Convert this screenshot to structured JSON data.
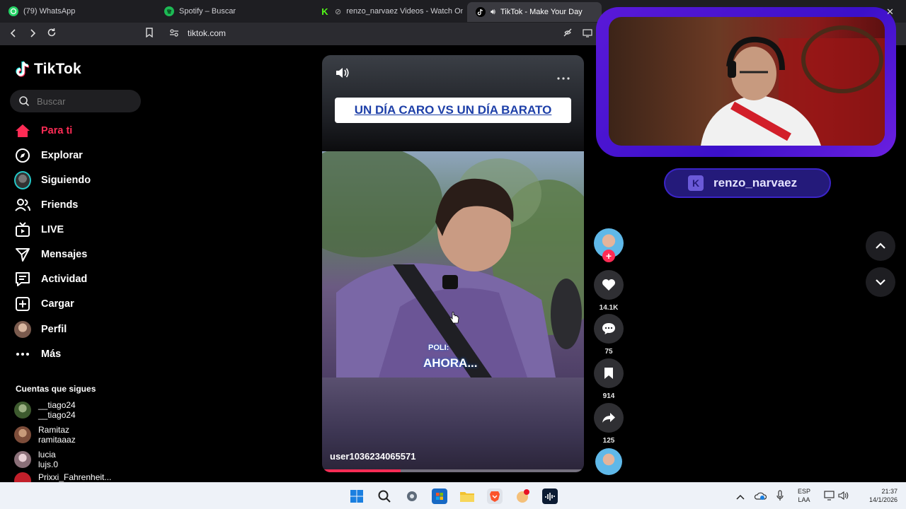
{
  "browser": {
    "tabs": [
      {
        "label": "(79) WhatsApp",
        "icon": "whatsapp-icon"
      },
      {
        "label": "Spotify – Buscar",
        "icon": "spotify-icon"
      },
      {
        "label": "renzo_narvaez Videos - Watch On",
        "icon": "kick-icon"
      },
      {
        "label": "TikTok - Make Your Day",
        "icon": "tiktok-icon",
        "active": true
      }
    ],
    "url": "tiktok.com"
  },
  "sidebar": {
    "logo": "TikTok",
    "search_placeholder": "Buscar",
    "nav": [
      {
        "label": "Para ti",
        "icon": "home-icon",
        "active": true
      },
      {
        "label": "Explorar",
        "icon": "compass-icon"
      },
      {
        "label": "Siguiendo",
        "icon": "following-avatar-icon"
      },
      {
        "label": "Friends",
        "icon": "friends-icon"
      },
      {
        "label": "LIVE",
        "icon": "live-tv-icon"
      },
      {
        "label": "Mensajes",
        "icon": "send-icon"
      },
      {
        "label": "Actividad",
        "icon": "activity-icon"
      },
      {
        "label": "Cargar",
        "icon": "upload-plus-icon"
      },
      {
        "label": "Perfil",
        "icon": "profile-avatar-icon"
      },
      {
        "label": "Más",
        "icon": "more-dots-icon"
      }
    ],
    "following_title": "Cuentas que sigues",
    "following": [
      {
        "name": "__tiago24",
        "handle": "__tiago24"
      },
      {
        "name": "Ramitaz",
        "handle": "ramitaaaz"
      },
      {
        "name": "lucia",
        "handle": "lujs.0"
      },
      {
        "name": "Prixxi_Fahrenheit...",
        "handle": ""
      }
    ]
  },
  "video": {
    "title_card": "UN DÍA CARO VS UN DÍA BARATO",
    "caption_small": "POLI:",
    "caption_big": "AHORA...",
    "username": "user1036234065571",
    "progress": 0.3
  },
  "actions": {
    "likes": "14.1K",
    "comments": "75",
    "saves": "914",
    "shares": "125"
  },
  "stream_overlay": {
    "streamer_name": "renzo_narvaez",
    "badge": "K"
  },
  "taskbar": {
    "language": "ESP",
    "layout": "LAA",
    "time": "21:37",
    "date": "14/1/2026"
  },
  "colors": {
    "tiktok_red": "#fe2c55",
    "overlay_purple": "#4b14d6"
  }
}
